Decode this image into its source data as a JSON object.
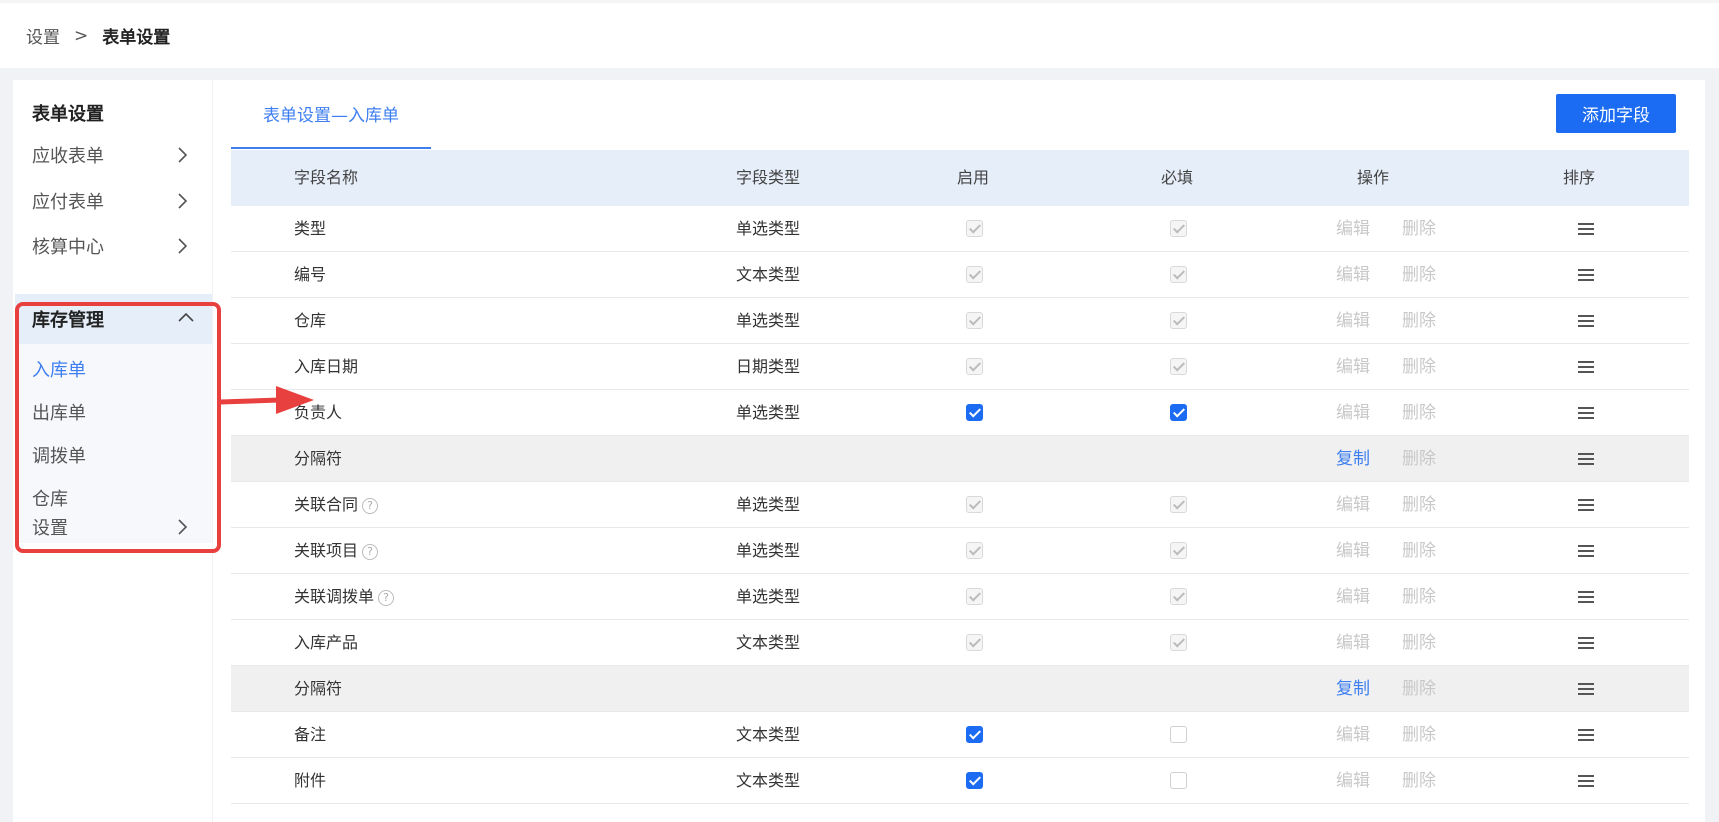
{
  "breadcrumb": {
    "root": "设置",
    "sep": ">",
    "current": "表单设置"
  },
  "sidebar": {
    "title": "表单设置",
    "items": [
      {
        "label": "应收表单"
      },
      {
        "label": "应付表单"
      },
      {
        "label": "核算中心"
      }
    ],
    "group": {
      "label": "库存管理",
      "children": [
        "入库单",
        "出库单",
        "调拨单",
        "仓库"
      ]
    },
    "footer_item": {
      "label": "设置"
    }
  },
  "main": {
    "tab": "表单设置—入库单",
    "add_button": "添加字段",
    "headers": {
      "name": "字段名称",
      "type": "字段类型",
      "enable": "启用",
      "required": "必填",
      "actions": "操作",
      "sort": "排序"
    },
    "rows": [
      {
        "name": "类型",
        "type": "单选类型",
        "edit": "编辑",
        "del": "删除"
      },
      {
        "name": "编号",
        "type": "文本类型",
        "edit": "编辑",
        "del": "删除"
      },
      {
        "name": "仓库",
        "type": "单选类型",
        "edit": "编辑",
        "del": "删除"
      },
      {
        "name": "入库日期",
        "type": "日期类型",
        "edit": "编辑",
        "del": "删除"
      },
      {
        "name": "负责人",
        "type": "单选类型",
        "edit": "编辑",
        "del": "删除"
      },
      {
        "name": "分隔符",
        "copy": "复制",
        "del": "删除"
      },
      {
        "name": "关联合同",
        "type": "单选类型",
        "edit": "编辑",
        "del": "删除"
      },
      {
        "name": "关联项目",
        "type": "单选类型",
        "edit": "编辑",
        "del": "删除"
      },
      {
        "name": "关联调拨单",
        "type": "单选类型",
        "edit": "编辑",
        "del": "删除"
      },
      {
        "name": "入库产品",
        "type": "文本类型",
        "edit": "编辑",
        "del": "删除"
      },
      {
        "name": "分隔符",
        "copy": "复制",
        "del": "删除"
      },
      {
        "name": "备注",
        "type": "文本类型",
        "edit": "编辑",
        "del": "删除"
      },
      {
        "name": "附件",
        "type": "文本类型",
        "edit": "编辑",
        "del": "删除"
      }
    ],
    "help_glyph": "?"
  },
  "colors": {
    "accent": "#1b6cf2",
    "link": "#3d7ef0",
    "highlight": "#e8403e"
  }
}
